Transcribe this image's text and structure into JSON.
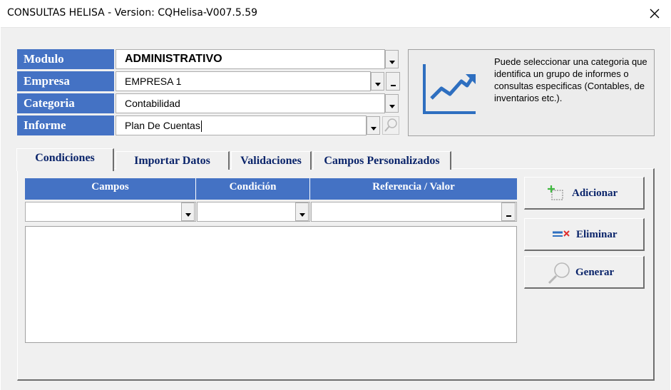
{
  "window": {
    "title": "CONSULTAS HELISA  - Version: CQHelisa-V007.5.59"
  },
  "form": {
    "modulo": {
      "label": "Modulo",
      "value": "ADMINISTRATIVO"
    },
    "empresa": {
      "label": "Empresa",
      "value": "EMPRESA 1"
    },
    "categoria": {
      "label": "Categoria",
      "value": "Contabilidad"
    },
    "informe": {
      "label": "Informe",
      "value": "Plan De Cuentas"
    }
  },
  "info": {
    "text": "Puede seleccionar una categoria que identifica un grupo de informes o consultas especificas (Contables, de inventarios etc.).",
    "icon": "line-chart-icon"
  },
  "tabs": [
    {
      "label": "Condiciones",
      "active": true
    },
    {
      "label": "Importar Datos",
      "active": false
    },
    {
      "label": "Validaciones",
      "active": false
    },
    {
      "label": "Campos Personalizados",
      "active": false
    }
  ],
  "grid": {
    "columns": [
      "Campos",
      "Condición",
      "Referencia / Valor"
    ]
  },
  "buttons": {
    "adicionar": "Adicionar",
    "eliminar": "Eliminar",
    "generar": "Generar"
  },
  "colors": {
    "accent": "#4472c4",
    "button_text": "#0a246a"
  }
}
